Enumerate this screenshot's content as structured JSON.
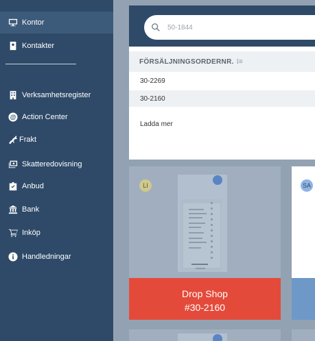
{
  "sidebar": {
    "items": [
      {
        "label": "Kontor",
        "icon": "monitor-icon",
        "active": true
      },
      {
        "label": "Kontakter",
        "icon": "contact-card-icon"
      },
      {
        "label": "Verksamhetsregister",
        "icon": "building-icon"
      },
      {
        "label": "Action Center",
        "icon": "at-sign-icon"
      },
      {
        "label": "Frakt",
        "icon": "horse-icon"
      },
      {
        "label": "Skatteredovisning",
        "icon": "tax-display-icon"
      },
      {
        "label": "Anbud",
        "icon": "clipboard-check-icon"
      },
      {
        "label": "Bank",
        "icon": "bank-icon"
      },
      {
        "label": "Inköp",
        "icon": "shopping-cart-icon"
      },
      {
        "label": "Handledningar",
        "icon": "info-icon"
      }
    ]
  },
  "search": {
    "value": "50-1844"
  },
  "results": {
    "column_header": "FÖRSÄLJNINGSORDERNR.",
    "rows": [
      "30-2269",
      "30-2160"
    ],
    "load_more": "Ladda mer"
  },
  "cards": [
    {
      "initials": "LI",
      "title": "Drop Shop",
      "number": "#30-2160",
      "color": "#e44a3a"
    },
    {
      "initials": "SA",
      "color": "#6e98c8"
    }
  ]
}
